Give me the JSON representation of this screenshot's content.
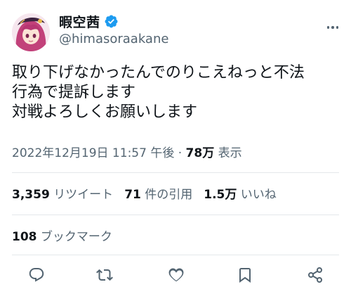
{
  "author": {
    "display_name": "暇空茜",
    "handle": "@himasoraakane",
    "verified": true
  },
  "tweet": {
    "lines": [
      "取り下げなかったんでのりこえねっと不法",
      "行為で提訴します",
      "対戦よろしくお願いします"
    ]
  },
  "meta": {
    "datetime": "2022年12月19日 11:57 午後",
    "separator": "·",
    "views_count": "78万",
    "views_label": "表示"
  },
  "stats": {
    "retweets_count": "3,359",
    "retweets_label": "リツイート",
    "quotes_count": "71",
    "quotes_label": "件の引用",
    "likes_count": "1.5万",
    "likes_label": "いいね",
    "bookmarks_count": "108",
    "bookmarks_label": "ブックマーク"
  },
  "icons": {
    "verified": "verified-badge-icon",
    "more": "more-options-icon",
    "reply": "reply-icon",
    "retweet": "retweet-icon",
    "like": "like-icon",
    "bookmark": "bookmark-icon",
    "share": "share-icon"
  },
  "colors": {
    "primary_text": "#0f1419",
    "secondary_text": "#536471",
    "verified_blue": "#1d9bf0",
    "divider": "#e4e8eb"
  }
}
